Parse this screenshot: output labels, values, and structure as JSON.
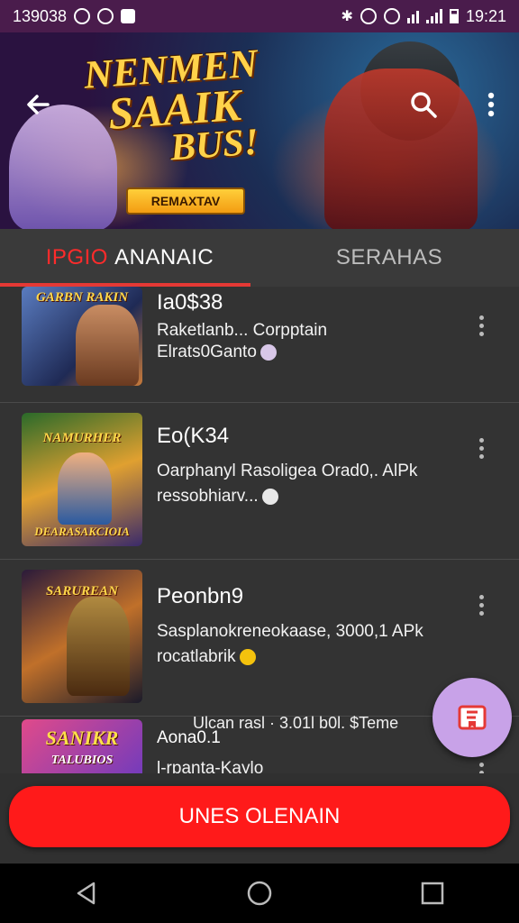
{
  "status_bar": {
    "left_text": "139038",
    "time": "19:21"
  },
  "banner": {
    "title_line1": "NENMEN",
    "title_line2": "SAAIK",
    "title_line3": "BUS!",
    "button_label": "REMAXTAV"
  },
  "toolbar": {
    "back_icon": "back-arrow-icon",
    "search_icon": "search-icon",
    "menu_icon": "more-vert-icon"
  },
  "tabs": [
    {
      "prefix": "IPGIO",
      "label": "ANANAIC",
      "active": true
    },
    {
      "label": "SERAHAS",
      "active": false
    }
  ],
  "items": [
    {
      "thumb_text": "GARBN RAKIN",
      "title": "Ia0$38",
      "line1": "Raketlanb... Corpptain",
      "line2": "Elrats0Ganto"
    },
    {
      "thumb_text": "NAMURHER",
      "thumb_text2": "DEARASAKCIOIA",
      "title": "Eo(K34",
      "line1": "Oarphanyl Rasoligea Orad0,. AlPk",
      "line2": "ressobhiarv..."
    },
    {
      "thumb_text": "SARUREAN",
      "title": "Peonbn9",
      "line1": "Sasplanokreneokaase, 3000,1 APk",
      "line2": "rocatlabrik"
    },
    {
      "thumb_text": "SANIKR",
      "thumb_text2": "TALUBIOS",
      "title": "Aona0.1",
      "line1": "l-rpanta-Kaylo"
    }
  ],
  "overlay_text": "Ulcan rasl · 3.01l b0l. $Teme",
  "cta_label": "UNES OLENAIN",
  "colors": {
    "accent": "#e53935",
    "fab": "#c8a2e8",
    "status_bar": "#4a1c4c"
  }
}
